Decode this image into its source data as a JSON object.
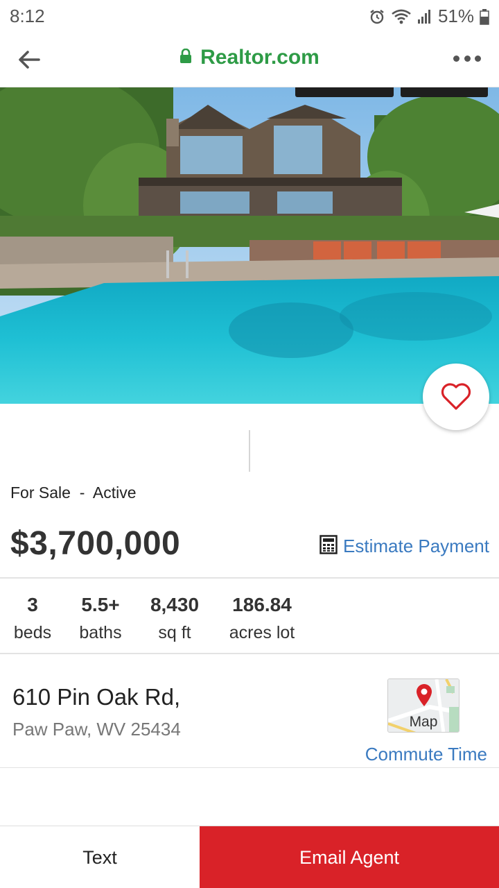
{
  "status_bar": {
    "time": "8:12",
    "battery": "51%",
    "icons": [
      "alarm-icon",
      "wifi-icon",
      "signal-icon",
      "battery-icon"
    ]
  },
  "browser": {
    "url": "Realtor.com",
    "back_icon": "back-arrow-icon",
    "lock_icon": "lock-icon",
    "menu_icon": "more-dots-icon"
  },
  "listing": {
    "status": "For Sale  -  Active",
    "price": "$3,700,000",
    "estimate_payment": "Estimate Payment",
    "facts": [
      {
        "value": "3",
        "label": "beds"
      },
      {
        "value": "5.5+",
        "label": "baths"
      },
      {
        "value": "8,430",
        "label": "sq ft"
      },
      {
        "value": "186.84",
        "label": "acres lot"
      }
    ],
    "address_line1": "610 Pin Oak Rd,",
    "address_line2": "Paw Paw, WV 25434",
    "map_label": "Map",
    "commute_time": "Commute Time"
  },
  "actions": {
    "text": "Text",
    "email_agent": "Email Agent"
  },
  "colors": {
    "brand_green": "#2e9b46",
    "link_blue": "#3a7ac0",
    "cta_red": "#d92228",
    "heart_red": "#d92228"
  }
}
